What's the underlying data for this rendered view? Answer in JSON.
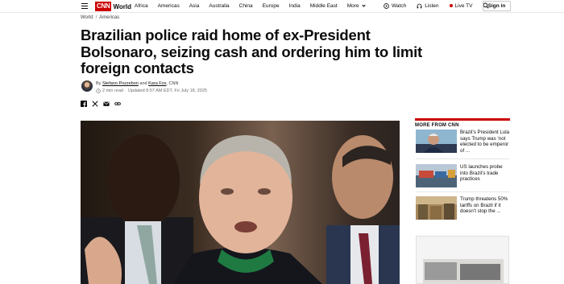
{
  "nav": {
    "logo_mark": "CNN",
    "logo_section": "World",
    "links": [
      "Africa",
      "Americas",
      "Asia",
      "Australia",
      "China",
      "Europe",
      "India",
      "Middle East"
    ],
    "more_label": "More",
    "watch_label": "Watch",
    "listen_label": "Listen",
    "live_tv_label": "Live TV",
    "sign_in_label": "Sign in"
  },
  "breadcrumb": [
    "World",
    "Americas"
  ],
  "article": {
    "headline": "Brazilian police raid home of ex-President Bolsonaro, seizing cash and ordering him to limit foreign contacts",
    "byline_prefix": "By ",
    "author1": "Stefano Pozzebon",
    "byline_and": " and ",
    "author2": "Kara Fox",
    "byline_suffix": ", CNN",
    "read_time": "2 min read",
    "updated": "Updated 8:57 AM EDT, Fri July 18, 2025"
  },
  "share_icons": [
    "facebook-icon",
    "x-icon",
    "email-icon",
    "link-icon"
  ],
  "sidebar": {
    "heading": "MORE FROM CNN",
    "items": [
      {
        "headline": "Brazil’s President Lula says Trump was ‘not elected to be emperor of ..."
      },
      {
        "headline": "US launches probe into Brazil’s trade practices"
      },
      {
        "headline": "Trump threatens 50% tariffs on Brazil if it doesn’t stop the ..."
      }
    ]
  },
  "colors": {
    "brand": "#cc0000",
    "text": "#0c0c0c",
    "muted": "#6e6e6e"
  }
}
